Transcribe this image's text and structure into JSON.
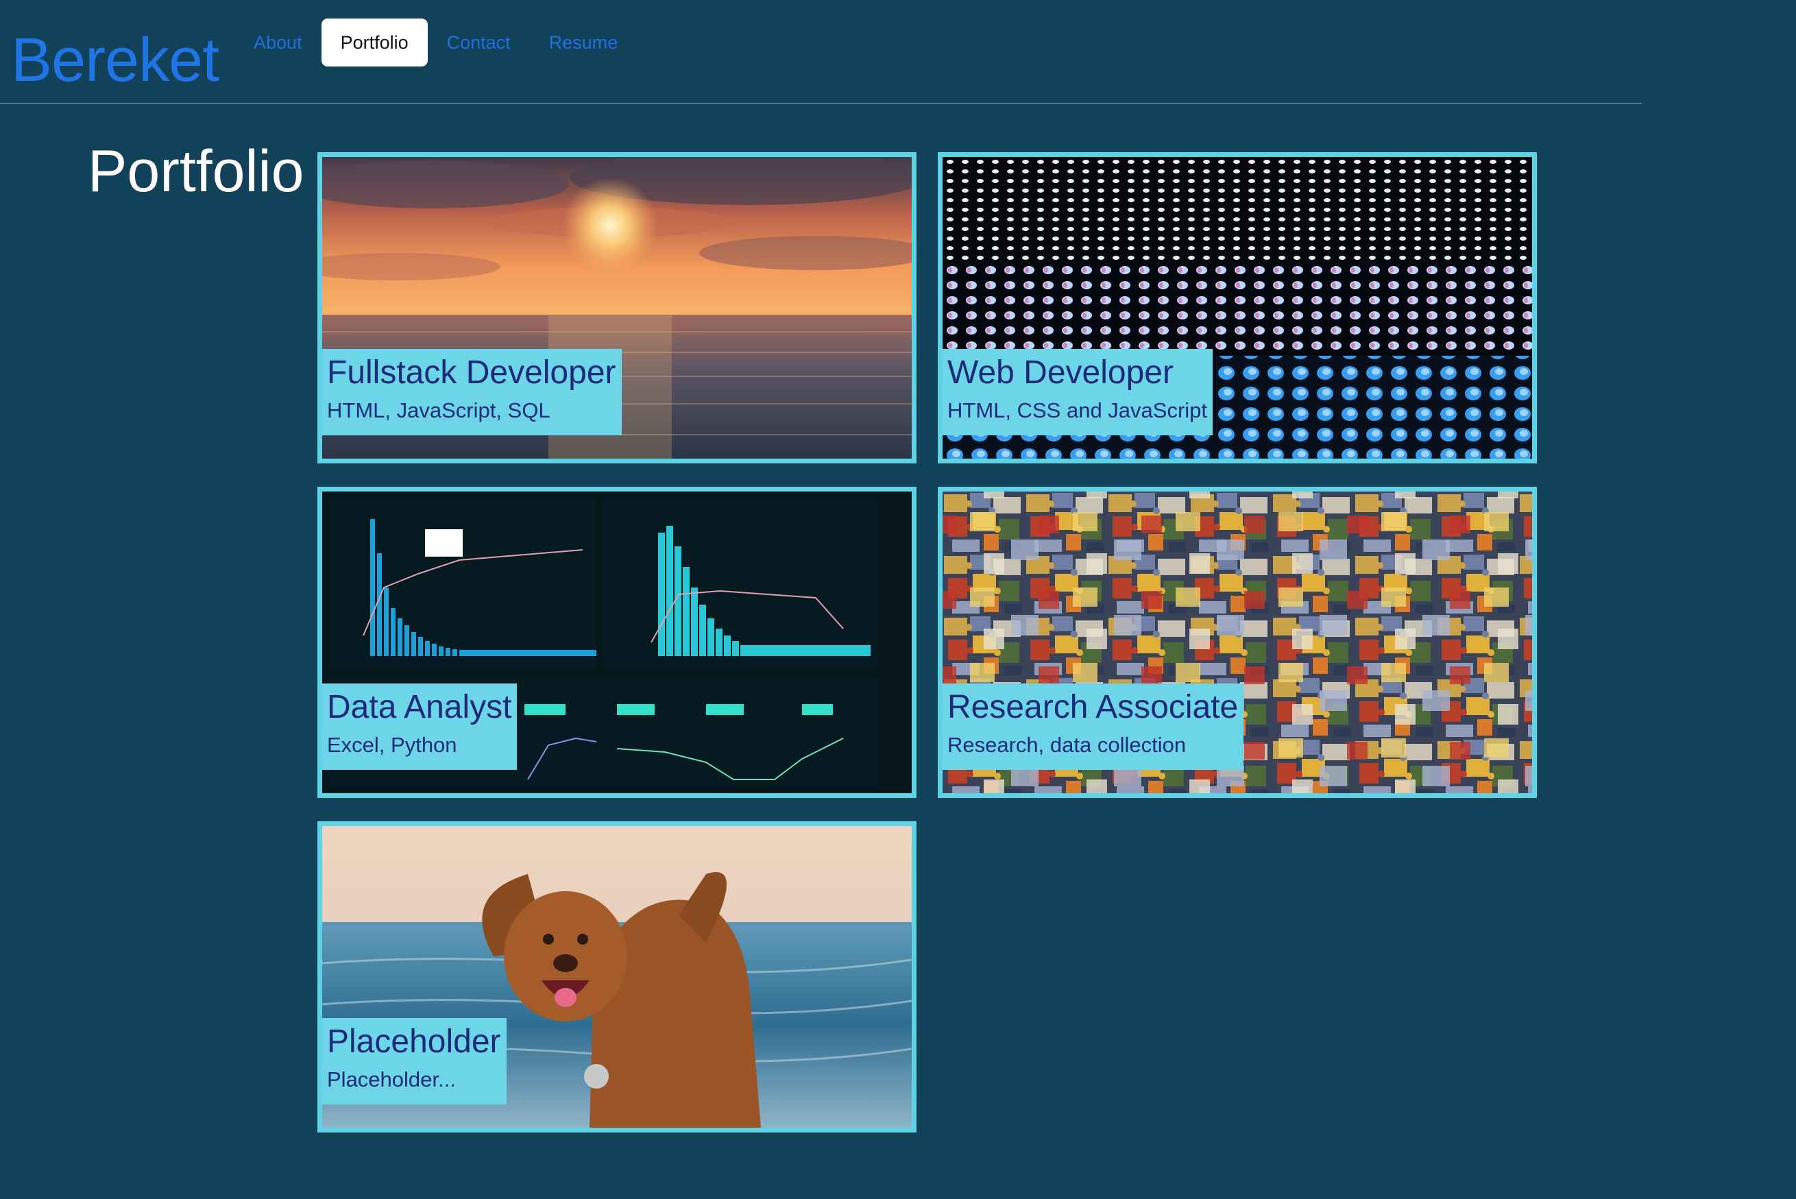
{
  "header": {
    "brand": "Bereket",
    "nav": [
      {
        "label": "About",
        "active": false
      },
      {
        "label": "Portfolio",
        "active": true
      },
      {
        "label": "Contact",
        "active": false
      },
      {
        "label": "Resume",
        "active": false
      }
    ]
  },
  "main": {
    "title": "Portfolio",
    "cards": [
      {
        "title": "Fullstack Developer",
        "subtitle": "HTML, JavaScript, SQL",
        "image": "ocean-sunset"
      },
      {
        "title": "Web Developer",
        "subtitle": "HTML, CSS and JavaScript",
        "image": "led-dot-grid"
      },
      {
        "title": "Data Analyst",
        "subtitle": "Excel, Python",
        "image": "analytics-dashboard"
      },
      {
        "title": "Research Associate",
        "subtitle": "Research, data collection",
        "image": "puzzle-pieces"
      },
      {
        "title": "Placeholder",
        "subtitle": "Placeholder...",
        "image": "dog-at-beach"
      }
    ]
  },
  "colors": {
    "background": "#12425a",
    "brand": "#1f75e6",
    "card_border": "#5fd3e6",
    "caption_bg": "#6cd6e8",
    "caption_text": "#1d2a7a"
  }
}
